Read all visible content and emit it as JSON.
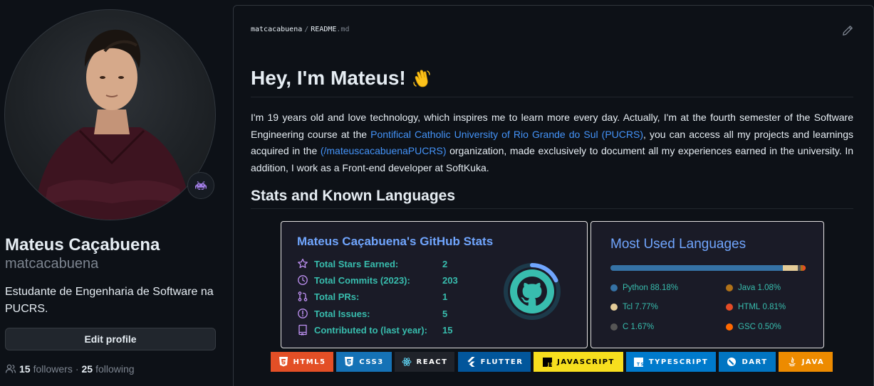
{
  "profile": {
    "fullname": "Mateus Caçabuena",
    "username": "matcacabuena",
    "bio": "Estudante de Engenharia de Software na PUCRS.",
    "edit_button": "Edit profile",
    "followers_count": "15",
    "followers_label": "followers",
    "separator": "·",
    "following_count": "25",
    "following_label": "following",
    "status_icon": "space-invader-icon"
  },
  "readme": {
    "path_user": "matcacabuena",
    "path_sep": "/",
    "path_file": "README",
    "path_ext": ".md",
    "heading": "Hey, I'm Mateus!",
    "heading_emoji": "waving-hand-icon",
    "para": {
      "t1": "I'm 19 years old and love technology, which inspires me to learn more every day. Actually, I'm at the fourth semester of the Software Engineering course at the ",
      "link1": "Pontifical Catholic University of Rio Grande do Sul (PUCRS)",
      "t2": ", you can access all my projects and learnings acquired in the ",
      "link2": "(/mateuscacabuenaPUCRS)",
      "t3": " organization, made exclusively to document all my experiences earned in the university. In addition, I work as a Front-end developer at SoftKuka."
    },
    "subheading": "Stats and Known Languages"
  },
  "stats": {
    "title": "Mateus Caçabuena's GitHub Stats",
    "rows": [
      {
        "label": "Total Stars Earned:",
        "value": "2",
        "icon": "star-icon"
      },
      {
        "label": "Total Commits (2023):",
        "value": "203",
        "icon": "clock-icon"
      },
      {
        "label": "Total PRs:",
        "value": "1",
        "icon": "pull-request-icon"
      },
      {
        "label": "Total Issues:",
        "value": "5",
        "icon": "issue-icon"
      },
      {
        "label": "Contributed to (last year):",
        "value": "15",
        "icon": "repo-icon"
      }
    ],
    "ring_progress": 0.18,
    "ring_icon": "github-octocat-icon"
  },
  "languages": {
    "title": "Most Used Languages",
    "items": [
      {
        "name": "Python",
        "percent": "88.18%",
        "value": 88.18,
        "color": "#3572a5"
      },
      {
        "name": "Tcl",
        "percent": "7.77%",
        "value": 7.77,
        "color": "#e4cc98"
      },
      {
        "name": "C",
        "percent": "1.67%",
        "value": 1.67,
        "color": "#555555"
      },
      {
        "name": "Java",
        "percent": "1.08%",
        "value": 1.08,
        "color": "#b07219"
      },
      {
        "name": "HTML",
        "percent": "0.81%",
        "value": 0.81,
        "color": "#e34c26"
      },
      {
        "name": "GSC",
        "percent": "0.50%",
        "value": 0.5,
        "color": "#ff6800"
      }
    ]
  },
  "badges": [
    {
      "label": "HTML5",
      "bg": "#e34f26",
      "icon": "html5-icon"
    },
    {
      "label": "CSS3",
      "bg": "#1572b6",
      "icon": "css3-icon"
    },
    {
      "label": "REACT",
      "bg": "#20232a",
      "icon": "react-icon"
    },
    {
      "label": "FLUTTER",
      "bg": "#02569b",
      "icon": "flutter-icon"
    },
    {
      "label": "JAVASCRIPT",
      "bg": "#f7df1e",
      "icon": "javascript-icon"
    },
    {
      "label": "TYPESCRIPT",
      "bg": "#007acc",
      "icon": "typescript-icon"
    },
    {
      "label": "DART",
      "bg": "#0175c2",
      "icon": "dart-icon"
    },
    {
      "label": "JAVA",
      "bg": "#ed8b00",
      "icon": "java-icon"
    }
  ]
}
